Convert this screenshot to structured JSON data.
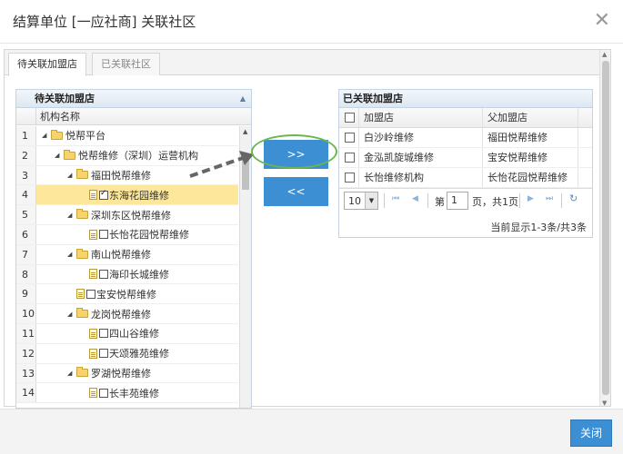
{
  "dialog": {
    "title": "结算单位 [一应社商] 关联社区",
    "close_glyph": "✕"
  },
  "tabs": [
    {
      "label": "待关联加盟店",
      "active": true
    },
    {
      "label": "已关联社区",
      "active": false
    }
  ],
  "left_panel": {
    "title": "待关联加盟店",
    "column_header": "机构名称",
    "rows": [
      {
        "num": "1",
        "label": "悦帮平台",
        "kind": "folder",
        "expanded": true,
        "level": 0
      },
      {
        "num": "2",
        "label": "悦帮维修（深圳）运营机构",
        "kind": "folder",
        "expanded": true,
        "level": 1
      },
      {
        "num": "3",
        "label": "福田悦帮维修",
        "kind": "folder",
        "expanded": true,
        "level": 2
      },
      {
        "num": "4",
        "label": "东海花园维修",
        "kind": "file",
        "checked": true,
        "selected": true,
        "level": 3
      },
      {
        "num": "5",
        "label": "深圳东区悦帮维修",
        "kind": "folder",
        "expanded": true,
        "level": 2
      },
      {
        "num": "6",
        "label": "长怡花园悦帮维修",
        "kind": "file",
        "checked": false,
        "level": 3
      },
      {
        "num": "7",
        "label": "南山悦帮维修",
        "kind": "folder",
        "expanded": true,
        "level": 2
      },
      {
        "num": "8",
        "label": "海印长城维修",
        "kind": "file",
        "checked": false,
        "level": 3
      },
      {
        "num": "9",
        "label": "宝安悦帮维修",
        "kind": "file",
        "checked": false,
        "level": 2
      },
      {
        "num": "10",
        "label": "龙岗悦帮维修",
        "kind": "folder",
        "expanded": true,
        "level": 2
      },
      {
        "num": "11",
        "label": "四山谷维修",
        "kind": "file",
        "checked": false,
        "level": 3
      },
      {
        "num": "12",
        "label": "天颂雅苑维修",
        "kind": "file",
        "checked": false,
        "level": 3
      },
      {
        "num": "13",
        "label": "罗湖悦帮维修",
        "kind": "folder",
        "expanded": true,
        "level": 2
      },
      {
        "num": "14",
        "label": "长丰苑维修",
        "kind": "file",
        "checked": false,
        "level": 3
      }
    ]
  },
  "transfer": {
    "add_label": ">>",
    "remove_label": "<<"
  },
  "right_panel": {
    "title": "已关联加盟店",
    "col_store": "加盟店",
    "col_parent": "父加盟店",
    "rows": [
      {
        "store": "白沙岭维修",
        "parent": "福田悦帮维修"
      },
      {
        "store": "金泓凯旋城维修",
        "parent": "宝安悦帮维修"
      },
      {
        "store": "长怡维修机构",
        "parent": "长怡花园悦帮维修"
      }
    ],
    "pager": {
      "page_size": "10",
      "page_prefix": "第",
      "page_value": "1",
      "page_suffix": "页，共1页",
      "info": "当前显示1-3条/共3条"
    }
  },
  "footer": {
    "close_label": "关闭"
  },
  "colors": {
    "primary_button": "#3d8fd3",
    "selected_row": "#fde79a",
    "annotation_ellipse": "#6ab64a"
  }
}
